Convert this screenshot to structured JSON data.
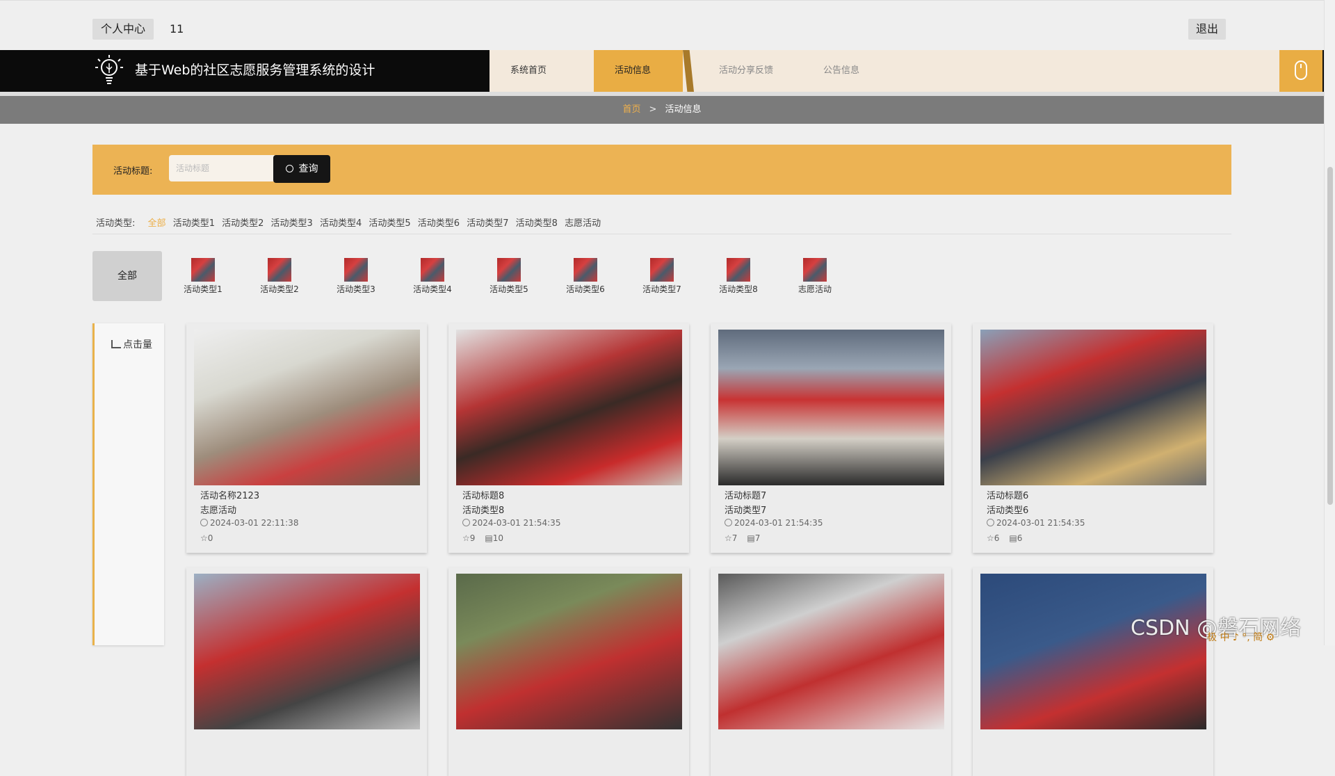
{
  "topbar": {
    "personal_center": "个人中心",
    "username": "11",
    "logout": "退出"
  },
  "header": {
    "site_title": "基于Web的社区志愿服务管理系统的设计"
  },
  "nav": [
    {
      "label": "系统首页"
    },
    {
      "label": "活动信息"
    },
    {
      "label": "活动分享反馈"
    },
    {
      "label": "公告信息"
    }
  ],
  "breadcrumb": {
    "home": "首页",
    "separator": ">",
    "current": "活动信息"
  },
  "search": {
    "label": "活动标题:",
    "placeholder": "活动标题",
    "button": "查询"
  },
  "type_filter": {
    "label": "活动类型:",
    "options": [
      "全部",
      "活动类型1",
      "活动类型2",
      "活动类型3",
      "活动类型4",
      "活动类型5",
      "活动类型6",
      "活动类型7",
      "活动类型8",
      "志愿活动"
    ]
  },
  "categories": {
    "all": "全部",
    "items": [
      "活动类型1",
      "活动类型2",
      "活动类型3",
      "活动类型4",
      "活动类型5",
      "活动类型6",
      "活动类型7",
      "活动类型8",
      "志愿活动"
    ]
  },
  "sidebar": {
    "sort_label": "点击量"
  },
  "cards": [
    {
      "title": "活动名称2123",
      "type": "志愿活动",
      "time": "2024-03-01 22:11:38",
      "likes": "0",
      "comments": ""
    },
    {
      "title": "活动标题8",
      "type": "活动类型8",
      "time": "2024-03-01 21:54:35",
      "likes": "9",
      "comments": "10"
    },
    {
      "title": "活动标题7",
      "type": "活动类型7",
      "time": "2024-03-01 21:54:35",
      "likes": "7",
      "comments": "7"
    },
    {
      "title": "活动标题6",
      "type": "活动类型6",
      "time": "2024-03-01 21:54:35",
      "likes": "6",
      "comments": "6"
    }
  ],
  "watermark": "CSDN @磐石网络",
  "ime_bar": "极 中 ♪ °, 简 ⚙",
  "colors": {
    "accent": "#ecb354",
    "nav_bg": "#0b0b0b",
    "nav_menu_bg": "#f3e9dc",
    "breadcrumb_bg": "#7b7b7b"
  }
}
